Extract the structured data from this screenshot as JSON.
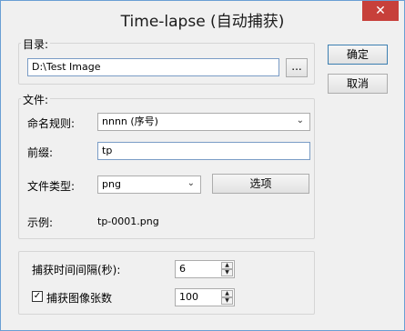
{
  "window": {
    "title": "Time-lapse (自动捕获)",
    "close_glyph": "✕"
  },
  "directory": {
    "group_label": "目录:",
    "path_value": "D:\\Test Image",
    "browse_label": "..."
  },
  "buttons": {
    "ok_label": "确定",
    "cancel_label": "取消"
  },
  "file": {
    "group_label": "文件:",
    "naming_rule_label": "命名规则:",
    "naming_rule_value": "nnnn (序号)",
    "prefix_label": "前缀:",
    "prefix_value": "tp",
    "file_type_label": "文件类型:",
    "file_type_value": "png",
    "options_label": "选项",
    "example_label": "示例:",
    "example_value": "tp-0001.png"
  },
  "capture": {
    "interval_label": "捕获时间间隔(秒):",
    "interval_value": "6",
    "count_checkbox_checked": true,
    "count_label": "捕获图像张数",
    "count_value": "100"
  }
}
